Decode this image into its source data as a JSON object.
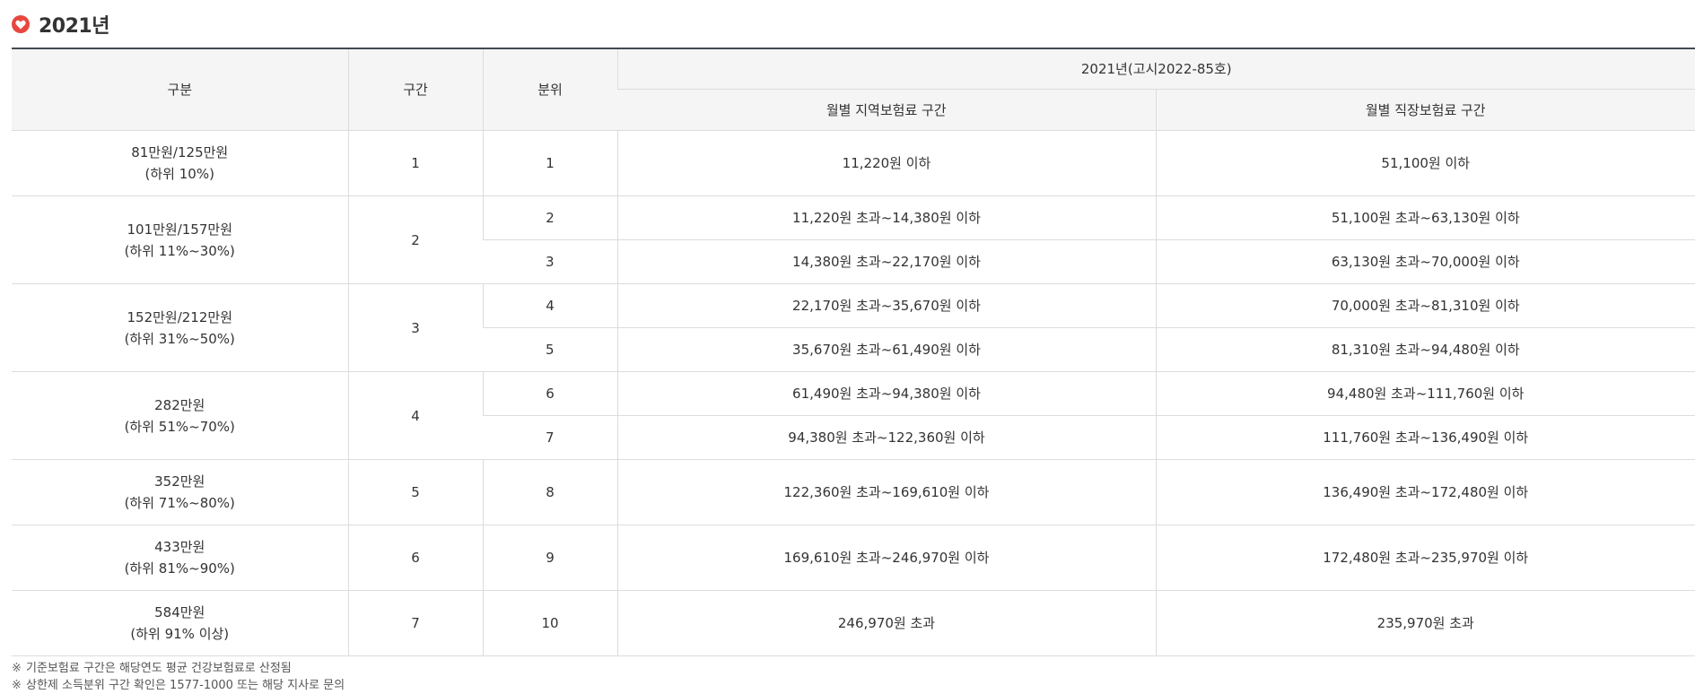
{
  "section": {
    "title": "2021년",
    "icon": "heart-icon",
    "icon_color": "#e8473f"
  },
  "table": {
    "headers": {
      "group": "구분",
      "band": "구간",
      "percentile": "분위",
      "year_notice": "2021년(고시2022-85호)",
      "regional": "월별 지역보험료 구간",
      "workplace": "월별 직장보험료 구간"
    },
    "groups": [
      {
        "income": "81만원/125만원",
        "range": "(하위 10%)",
        "band": "1",
        "rows": [
          {
            "pct": "1",
            "regional": "11,220원 이하",
            "workplace": "51,100원 이하"
          }
        ]
      },
      {
        "income": "101만원/157만원",
        "range": "(하위 11%~30%)",
        "band": "2",
        "rows": [
          {
            "pct": "2",
            "regional": "11,220원 초과~14,380원 이하",
            "workplace": "51,100원 초과~63,130원 이하"
          },
          {
            "pct": "3",
            "regional": "14,380원 초과~22,170원 이하",
            "workplace": "63,130원 초과~70,000원 이하"
          }
        ]
      },
      {
        "income": "152만원/212만원",
        "range": "(하위 31%~50%)",
        "band": "3",
        "rows": [
          {
            "pct": "4",
            "regional": "22,170원 초과~35,670원 이하",
            "workplace": "70,000원 초과~81,310원 이하"
          },
          {
            "pct": "5",
            "regional": "35,670원 초과~61,490원 이하",
            "workplace": "81,310원 초과~94,480원 이하"
          }
        ]
      },
      {
        "income": "282만원",
        "range": "(하위 51%~70%)",
        "band": "4",
        "rows": [
          {
            "pct": "6",
            "regional": "61,490원 초과~94,380원 이하",
            "workplace": "94,480원 초과~111,760원 이하"
          },
          {
            "pct": "7",
            "regional": "94,380원 초과~122,360원 이하",
            "workplace": "111,760원 초과~136,490원 이하"
          }
        ]
      },
      {
        "income": "352만원",
        "range": "(하위 71%~80%)",
        "band": "5",
        "rows": [
          {
            "pct": "8",
            "regional": "122,360원 초과~169,610원 이하",
            "workplace": "136,490원 초과~172,480원 이하"
          }
        ]
      },
      {
        "income": "433만원",
        "range": "(하위 81%~90%)",
        "band": "6",
        "rows": [
          {
            "pct": "9",
            "regional": "169,610원 초과~246,970원 이하",
            "workplace": "172,480원 초과~235,970원 이하"
          }
        ]
      },
      {
        "income": "584만원",
        "range": "(하위 91% 이상)",
        "band": "7",
        "rows": [
          {
            "pct": "10",
            "regional": "246,970원 초과",
            "workplace": "235,970원 초과"
          }
        ]
      }
    ]
  },
  "notes": {
    "mark": "※",
    "items": [
      "기준보험료 구간은 해당연도 평균 건강보험료로 산정됨",
      "상한제 소득분위 구간 확인은 1577-1000 또는 해당 지사로 문의"
    ]
  }
}
